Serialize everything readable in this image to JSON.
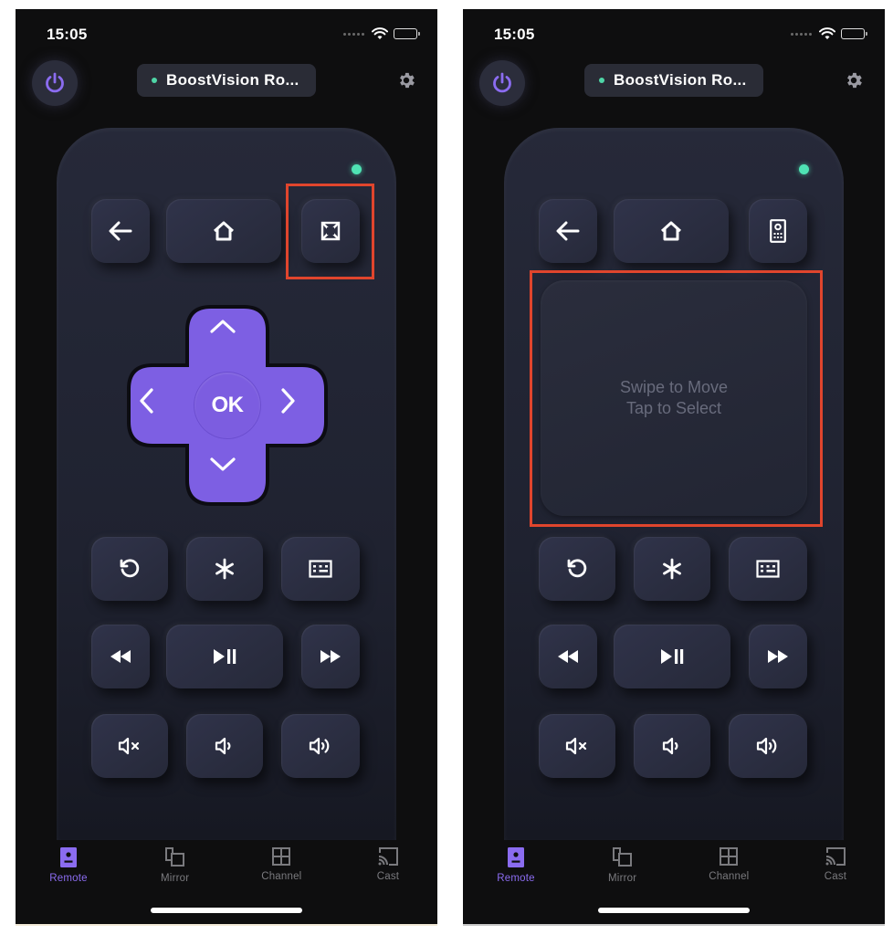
{
  "colors": {
    "accent": "#8b6cf0",
    "dpad": "#7d5fe3",
    "led": "#4fe3b4",
    "highlight": "#e0452d",
    "screen_bg": "#0e0e0f",
    "key_bg": "#2b2e40"
  },
  "screens": [
    {
      "status": {
        "time": "15:05",
        "icons": [
          "signal-dots-icon",
          "wifi-icon",
          "battery-icon"
        ]
      },
      "header": {
        "power_icon": "power-icon",
        "device_name": "BoostVision Ro...",
        "connection_status": "connected",
        "settings_icon": "gear-icon"
      },
      "top_keys": [
        {
          "name": "back",
          "icon": "arrow-left-icon"
        },
        {
          "name": "home",
          "icon": "home-icon"
        },
        {
          "name": "touchpad-toggle",
          "icon": "fullscreen-icon",
          "highlighted": true
        }
      ],
      "dpad": {
        "ok_label": "OK",
        "arrows": [
          "chevron-up-icon",
          "chevron-left-icon",
          "chevron-right-icon",
          "chevron-down-icon"
        ]
      },
      "keys": [
        {
          "name": "replay",
          "icon": "replay-icon"
        },
        {
          "name": "options",
          "icon": "asterisk-icon"
        },
        {
          "name": "keyboard",
          "icon": "keyboard-icon"
        },
        {
          "name": "rewind",
          "icon": "rewind-icon"
        },
        {
          "name": "play-pause",
          "icon": "play-pause-icon"
        },
        {
          "name": "fast-forward",
          "icon": "fast-forward-icon"
        },
        {
          "name": "mute",
          "icon": "volume-mute-icon"
        },
        {
          "name": "volume-down",
          "icon": "volume-down-icon"
        },
        {
          "name": "volume-up",
          "icon": "volume-up-icon"
        }
      ],
      "tabs": [
        {
          "label": "Remote",
          "icon": "remote-icon",
          "active": true
        },
        {
          "label": "Mirror",
          "icon": "mirror-icon",
          "active": false
        },
        {
          "label": "Channel",
          "icon": "channel-grid-icon",
          "active": false
        },
        {
          "label": "Cast",
          "icon": "cast-icon",
          "active": false
        }
      ]
    },
    {
      "status": {
        "time": "15:05",
        "icons": [
          "signal-dots-icon",
          "wifi-icon",
          "battery-icon"
        ]
      },
      "header": {
        "power_icon": "power-icon",
        "device_name": "BoostVision Ro...",
        "connection_status": "connected",
        "settings_icon": "gear-icon"
      },
      "top_keys": [
        {
          "name": "back",
          "icon": "arrow-left-icon"
        },
        {
          "name": "home",
          "icon": "home-icon"
        },
        {
          "name": "remote-toggle",
          "icon": "remote-device-icon"
        }
      ],
      "touchpad": {
        "line1": "Swipe to Move",
        "line2": "Tap to Select",
        "highlighted": true
      },
      "keys": [
        {
          "name": "replay",
          "icon": "replay-icon"
        },
        {
          "name": "options",
          "icon": "asterisk-icon"
        },
        {
          "name": "keyboard",
          "icon": "keyboard-icon"
        },
        {
          "name": "rewind",
          "icon": "rewind-icon"
        },
        {
          "name": "play-pause",
          "icon": "play-pause-icon"
        },
        {
          "name": "fast-forward",
          "icon": "fast-forward-icon"
        },
        {
          "name": "mute",
          "icon": "volume-mute-icon"
        },
        {
          "name": "volume-down",
          "icon": "volume-down-icon"
        },
        {
          "name": "volume-up",
          "icon": "volume-up-icon"
        }
      ],
      "tabs": [
        {
          "label": "Remote",
          "icon": "remote-icon",
          "active": true
        },
        {
          "label": "Mirror",
          "icon": "mirror-icon",
          "active": false
        },
        {
          "label": "Channel",
          "icon": "channel-grid-icon",
          "active": false
        },
        {
          "label": "Cast",
          "icon": "cast-icon",
          "active": false
        }
      ]
    }
  ]
}
